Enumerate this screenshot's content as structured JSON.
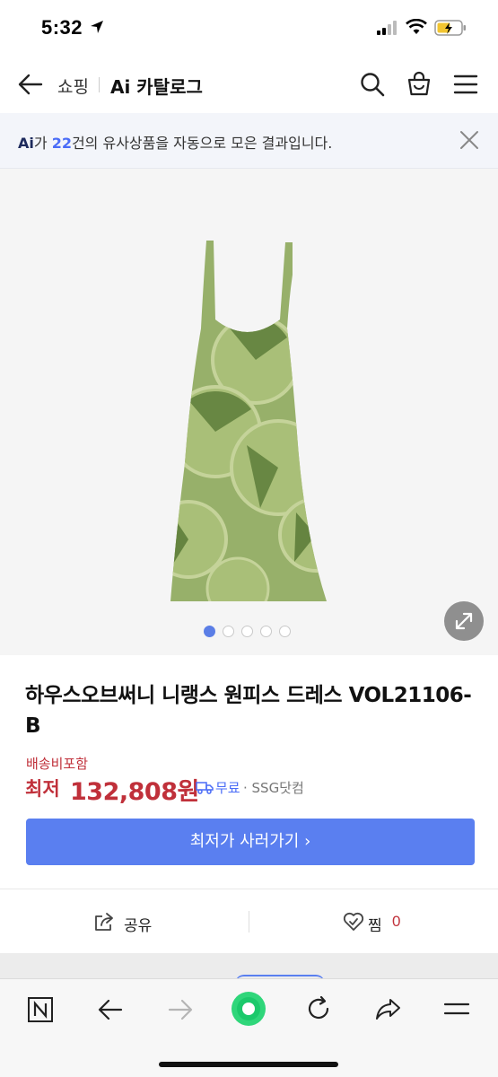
{
  "status_bar": {
    "time": "5:32"
  },
  "nav": {
    "shopping_label": "쇼핑",
    "title": "Ai 카탈로그"
  },
  "ai_banner": {
    "logo": "Ai",
    "prefix": "가 ",
    "count": "22",
    "suffix": "건의 유사상품을 자동으로 모은 결과입니다."
  },
  "gallery": {
    "page_count": 5,
    "active_index": 0,
    "colors": {
      "dress": "#97b06a",
      "pattern_dark": "#5d7d3a",
      "pattern_light": "#c5d39a"
    }
  },
  "product": {
    "title": "하우스오브써니 니랭스 원피스 드레스 VOL21106-B",
    "shipping_note": "배송비포함",
    "price_label": "최저",
    "price": "132,808원",
    "shipping_fee": "무료",
    "seller": "· SSG닷컴",
    "buy_button": "최저가 사러가기 ›"
  },
  "actions": {
    "share_label": "공유",
    "like_label": "찜",
    "like_count": "0"
  },
  "theme": {
    "accent": "#5a7ff0",
    "price_red": "#c0303a"
  }
}
